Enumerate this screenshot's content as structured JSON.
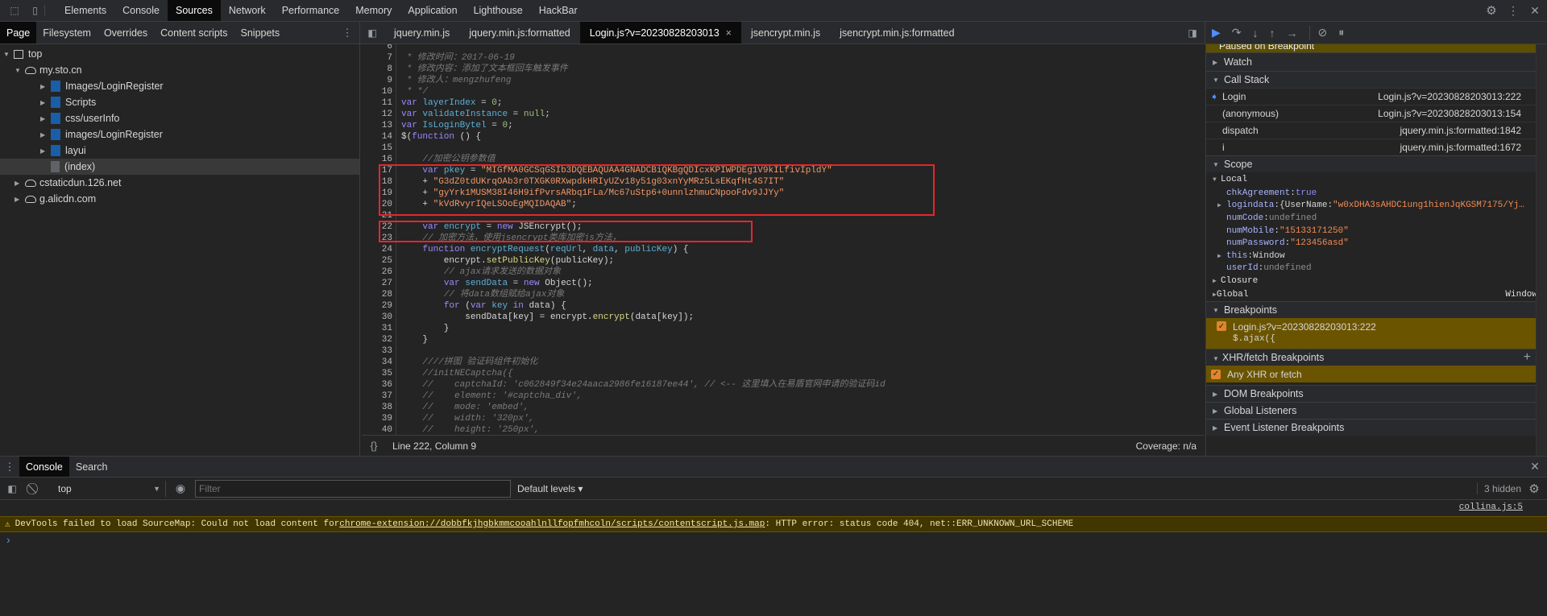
{
  "top_tabs": [
    "Elements",
    "Console",
    "Sources",
    "Network",
    "Performance",
    "Memory",
    "Application",
    "Lighthouse",
    "HackBar"
  ],
  "selected_top_tab": "Sources",
  "navigator_tabs": [
    "Page",
    "Filesystem",
    "Overrides",
    "Content scripts",
    "Snippets"
  ],
  "editor_tabs": [
    "jquery.min.js",
    "jquery.min.js:formatted",
    "Login.js?v=20230828203013",
    "jsencrypt.min.js",
    "jsencrypt.min.js:formatted"
  ],
  "selected_editor_tab": "Login.js?v=20230828203013",
  "tree": [
    {
      "label": "top",
      "level": 0,
      "type": "frame",
      "open": true
    },
    {
      "label": "my.sto.cn",
      "level": 1,
      "type": "cloud",
      "open": true
    },
    {
      "label": "Images/LoginRegister",
      "level": 2,
      "type": "folder"
    },
    {
      "label": "Scripts",
      "level": 2,
      "type": "folder"
    },
    {
      "label": "css/userInfo",
      "level": 2,
      "type": "folder"
    },
    {
      "label": "images/LoginRegister",
      "level": 2,
      "type": "folder"
    },
    {
      "label": "layui",
      "level": 2,
      "type": "folder"
    },
    {
      "label": "(index)",
      "level": 2,
      "type": "file",
      "selected": true
    },
    {
      "label": "cstaticdun.126.net",
      "level": 1,
      "type": "cloud"
    },
    {
      "label": "g.alicdn.com",
      "level": 1,
      "type": "cloud"
    }
  ],
  "code": {
    "first_line": 6,
    "lines": [
      [],
      [
        [
          "c",
          " * 修改时间：2017-06-19"
        ]
      ],
      [
        [
          "c",
          " * 修改内容：添加了文本框回车触发事件"
        ]
      ],
      [
        [
          "c",
          " * 修改人：mengzhufeng"
        ]
      ],
      [
        [
          "c",
          " * */"
        ]
      ],
      [
        [
          "k",
          "var"
        ],
        [
          "p",
          " "
        ],
        [
          "v",
          "layerIndex"
        ],
        [
          "p",
          " = "
        ],
        [
          "n",
          "0"
        ],
        [
          "p",
          ";"
        ]
      ],
      [
        [
          "k",
          "var"
        ],
        [
          "p",
          " "
        ],
        [
          "v",
          "validateInstance"
        ],
        [
          "p",
          " = "
        ],
        [
          "n",
          "null"
        ],
        [
          "p",
          ";"
        ]
      ],
      [
        [
          "k",
          "var"
        ],
        [
          "p",
          " "
        ],
        [
          "v",
          "IsLoginBytel"
        ],
        [
          "p",
          " = "
        ],
        [
          "n",
          "0"
        ],
        [
          "p",
          ";"
        ]
      ],
      [
        [
          "p",
          "$("
        ],
        [
          "k",
          "function"
        ],
        [
          "p",
          " () {"
        ]
      ],
      [],
      [
        [
          "p",
          "    "
        ],
        [
          "c",
          "//加密公钥参数值"
        ]
      ],
      [
        [
          "p",
          "    "
        ],
        [
          "k",
          "var"
        ],
        [
          "p",
          " "
        ],
        [
          "v",
          "pkey"
        ],
        [
          "p",
          " = "
        ],
        [
          "s",
          "\"MIGfMA0GCSqGSIb3DQEBAQUAA4GNADCBiQKBgQDIcxKPIWPDEg1V9kILfivIpldY\""
        ]
      ],
      [
        [
          "p",
          "    + "
        ],
        [
          "s",
          "\"G3dZ0tdUKrqOAb3r0TXGK0RXwpdkHRIyUZv18y51g03xnYyMRz5LsEKqfHt4S7IT\""
        ]
      ],
      [
        [
          "p",
          "    + "
        ],
        [
          "s",
          "\"gyYrk1MUSM38I46H9ifPvrsARbq1FLa/Mc67uStp6+0unnlzhmuCNpooFdv9JJYy\""
        ]
      ],
      [
        [
          "p",
          "    + "
        ],
        [
          "s",
          "\"kVdRvyrIQeLSOoEgMQIDAQAB\""
        ],
        [
          "p",
          ";"
        ]
      ],
      [],
      [
        [
          "p",
          "    "
        ],
        [
          "k",
          "var"
        ],
        [
          "p",
          " "
        ],
        [
          "v",
          "encrypt"
        ],
        [
          "p",
          " = "
        ],
        [
          "k",
          "new"
        ],
        [
          "p",
          " JSEncrypt();"
        ]
      ],
      [
        [
          "p",
          "    "
        ],
        [
          "c",
          "// 加密方法，使用jsencrypt类库加密js方法，"
        ]
      ],
      [
        [
          "p",
          "    "
        ],
        [
          "k",
          "function"
        ],
        [
          "p",
          " "
        ],
        [
          "v",
          "encryptRequest"
        ],
        [
          "p",
          "("
        ],
        [
          "v",
          "reqUrl"
        ],
        [
          "p",
          ", "
        ],
        [
          "v",
          "data"
        ],
        [
          "p",
          ", "
        ],
        [
          "v",
          "publicKey"
        ],
        [
          "p",
          ") {"
        ]
      ],
      [
        [
          "p",
          "        encrypt."
        ],
        [
          "f",
          "setPublicKey"
        ],
        [
          "p",
          "(publicKey);"
        ]
      ],
      [
        [
          "p",
          "        "
        ],
        [
          "c",
          "// ajax请求发送的数据对象"
        ]
      ],
      [
        [
          "p",
          "        "
        ],
        [
          "k",
          "var"
        ],
        [
          "p",
          " "
        ],
        [
          "v",
          "sendData"
        ],
        [
          "p",
          " = "
        ],
        [
          "k",
          "new"
        ],
        [
          "p",
          " Object();"
        ]
      ],
      [
        [
          "p",
          "        "
        ],
        [
          "c",
          "// 将data数组赋给ajax对象"
        ]
      ],
      [
        [
          "p",
          "        "
        ],
        [
          "k",
          "for"
        ],
        [
          "p",
          " ("
        ],
        [
          "k",
          "var"
        ],
        [
          "p",
          " "
        ],
        [
          "v",
          "key"
        ],
        [
          "p",
          " "
        ],
        [
          "k",
          "in"
        ],
        [
          "p",
          " data) {"
        ]
      ],
      [
        [
          "p",
          "            sendData[key] = encrypt."
        ],
        [
          "f",
          "encrypt"
        ],
        [
          "p",
          "(data[key]);"
        ]
      ],
      [
        [
          "p",
          "        }"
        ]
      ],
      [
        [
          "p",
          "    }"
        ]
      ],
      [],
      [
        [
          "p",
          "    "
        ],
        [
          "c",
          "////拼图 验证码组件初始化"
        ]
      ],
      [
        [
          "p",
          "    "
        ],
        [
          "c",
          "//initNECaptcha({"
        ]
      ],
      [
        [
          "p",
          "    "
        ],
        [
          "c",
          "//    captchaId: 'c062849f34e24aaca2986fe16187ee44', // <-- 这里填入在易盾官网申请的验证码id"
        ]
      ],
      [
        [
          "p",
          "    "
        ],
        [
          "c",
          "//    element: '#captcha_div',"
        ]
      ],
      [
        [
          "p",
          "    "
        ],
        [
          "c",
          "//    mode: 'embed',"
        ]
      ],
      [
        [
          "p",
          "    "
        ],
        [
          "c",
          "//    width: '320px',"
        ]
      ],
      [
        [
          "p",
          "    "
        ],
        [
          "c",
          "//    height: '250px',"
        ]
      ]
    ]
  },
  "status": {
    "position": "Line 222, Column 9",
    "coverage": "Coverage: n/a"
  },
  "debugger": {
    "paused": "Paused on Breakpoint",
    "watch": "Watch",
    "call_stack_title": "Call Stack",
    "call_stack": [
      {
        "name": "Login",
        "location": "Login.js?v=20230828203013:222",
        "current": true
      },
      {
        "name": "(anonymous)",
        "location": "Login.js?v=20230828203013:154"
      },
      {
        "name": "dispatch",
        "location": "jquery.min.js:formatted:1842"
      },
      {
        "name": "i",
        "location": "jquery.min.js:formatted:1672"
      }
    ],
    "scope_title": "Scope",
    "local_title": "Local",
    "local": [
      {
        "key": "chkAgreement",
        "value": "true",
        "kind": "tru"
      },
      {
        "key": "logindata",
        "value": "{UserName: \"w0xDHA3sAHDC1ung1hienJqKGSM7175/Yj…",
        "kind": "obj",
        "expandable": true
      },
      {
        "key": "numCode",
        "value": "undefined",
        "kind": "undef"
      },
      {
        "key": "numMobile",
        "value": "\"15133171250\"",
        "kind": "sv"
      },
      {
        "key": "numPassword",
        "value": "\"123456asd\"",
        "kind": "sv"
      },
      {
        "key": "this",
        "value": "Window",
        "kind": "p",
        "expandable": true
      },
      {
        "key": "userId",
        "value": "undefined",
        "kind": "undef"
      }
    ],
    "closure": "Closure",
    "global": "Global",
    "global_value": "Window",
    "breakpoints_title": "Breakpoints",
    "breakpoint": {
      "file": "Login.js?v=20230828203013:222",
      "code": "$.ajax({"
    },
    "xhr_title": "XHR/fetch Breakpoints",
    "xhr_item": "Any XHR or fetch",
    "dom": "DOM Breakpoints",
    "global_listeners": "Global Listeners",
    "event_listeners": "Event Listener Breakpoints"
  },
  "console": {
    "tabs": [
      "Console",
      "Search"
    ],
    "context": "top",
    "filter_placeholder": "Filter",
    "levels": "Default levels ▾",
    "hidden": "3 hidden",
    "source_link": "collina.js:5",
    "warning": {
      "prefix": "DevTools failed to load SourceMap: Could not load content for ",
      "url": "chrome-extension://dobbfkjhgbkmmcooahlnllfopfmhcoln/scripts/contentscript.js.map",
      "suffix": ": HTTP error: status code 404, net::ERR_UNKNOWN_URL_SCHEME"
    },
    "prompt": "›"
  },
  "colors": {
    "highlight_box": "#e8252b",
    "paused_bar": "#5c4f00",
    "breakpoint_bg": "#6b5400",
    "checkbox": "#e0852b"
  }
}
